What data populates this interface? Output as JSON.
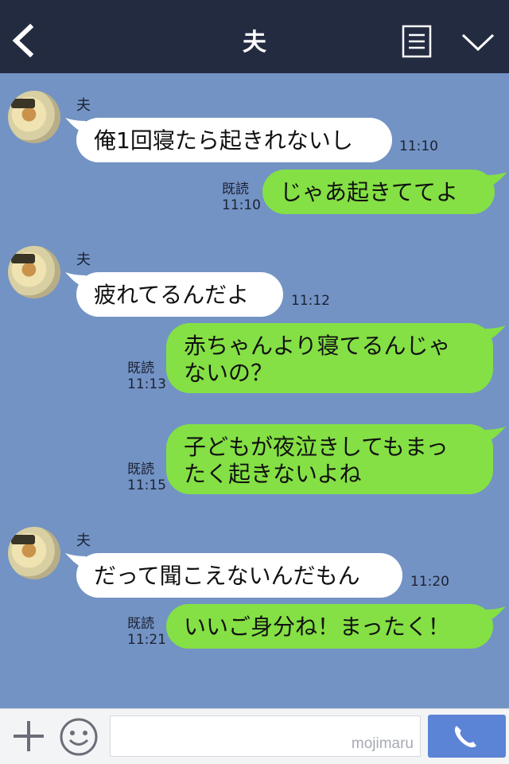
{
  "header": {
    "title": "夫",
    "back_icon": "chevron-left-icon",
    "menu_icon": "list-icon",
    "expand_icon": "chevron-down-icon",
    "background": "#232b41"
  },
  "chat": {
    "background": "#7393c4",
    "read_label": "既読",
    "messages": [
      {
        "sender": "夫",
        "text": "俺1回寝たら起きれないし",
        "time": "11:10",
        "direction": "in"
      },
      {
        "text": "じゃあ起きててよ",
        "time": "11:10",
        "read": "既読",
        "direction": "out"
      },
      {
        "sender": "夫",
        "text": "疲れてるんだよ",
        "time": "11:12",
        "direction": "in"
      },
      {
        "text": "赤ちゃんより寝てるんじゃ\nないの？",
        "time": "11:13",
        "read": "既読",
        "direction": "out"
      },
      {
        "text": "子どもが夜泣きしてもまっ\nたく起きないよね",
        "time": "11:15",
        "read": "既読",
        "direction": "out"
      },
      {
        "sender": "夫",
        "text": "だって聞こえないんだもん",
        "time": "11:20",
        "direction": "in"
      },
      {
        "text": "いいご身分ね！まったく！",
        "time": "11:21",
        "read": "既読",
        "direction": "out"
      }
    ],
    "incoming_color": "#ffffff",
    "outgoing_color": "#84e044"
  },
  "footer": {
    "plus_icon": "plus-icon",
    "emoji_icon": "smiley-icon",
    "input_value": "",
    "watermark": "mojimaru",
    "call_icon": "phone-icon",
    "call_color": "#5b84d6"
  }
}
